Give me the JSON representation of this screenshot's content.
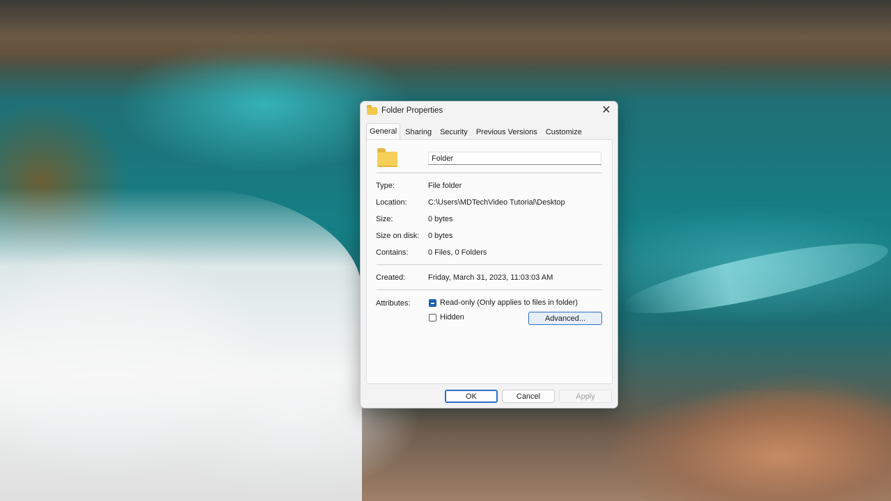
{
  "dialog": {
    "title": "Folder Properties",
    "tabs": [
      "General",
      "Sharing",
      "Security",
      "Previous Versions",
      "Customize"
    ],
    "active_tab": "General",
    "folder_name": "Folder",
    "details": [
      {
        "label": "Type:",
        "value": "File folder"
      },
      {
        "label": "Location:",
        "value": "C:\\Users\\MDTechVideo Tutorial\\Desktop"
      },
      {
        "label": "Size:",
        "value": "0 bytes"
      },
      {
        "label": "Size on disk:",
        "value": "0 bytes"
      },
      {
        "label": "Contains:",
        "value": "0 Files, 0 Folders"
      }
    ],
    "created": {
      "label": "Created:",
      "value": "Friday, March 31, 2023, 11:03:03 AM"
    },
    "attributes": {
      "label": "Attributes:",
      "readonly_label": "Read-only (Only applies to files in folder)",
      "readonly_state": "indeterminate",
      "hidden_label": "Hidden",
      "hidden_checked": false,
      "advanced_label": "Advanced..."
    },
    "buttons": {
      "ok": "OK",
      "cancel": "Cancel",
      "apply": "Apply"
    },
    "close_glyph": "✕"
  },
  "colors": {
    "accent": "#2a6fc9",
    "folder": "#f5cf57"
  },
  "icons": {
    "title": "folder-icon",
    "close": "close-icon",
    "large": "folder-icon"
  }
}
